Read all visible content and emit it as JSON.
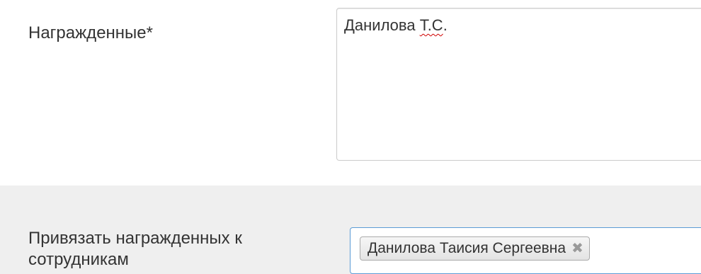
{
  "awarded": {
    "label": "Награжденные*",
    "value_name": "Данилова ",
    "value_initials": "Т.С",
    "value_end": "."
  },
  "link_employees": {
    "label": "Привязать награжденных к сотрудникам",
    "selected_tag": "Данилова Таисия Сергеевна",
    "remove_symbol": "✖",
    "remove_icon": "close-icon"
  },
  "colors": {
    "section_bg": "#efefef",
    "focus_border": "#5b9bd5"
  }
}
